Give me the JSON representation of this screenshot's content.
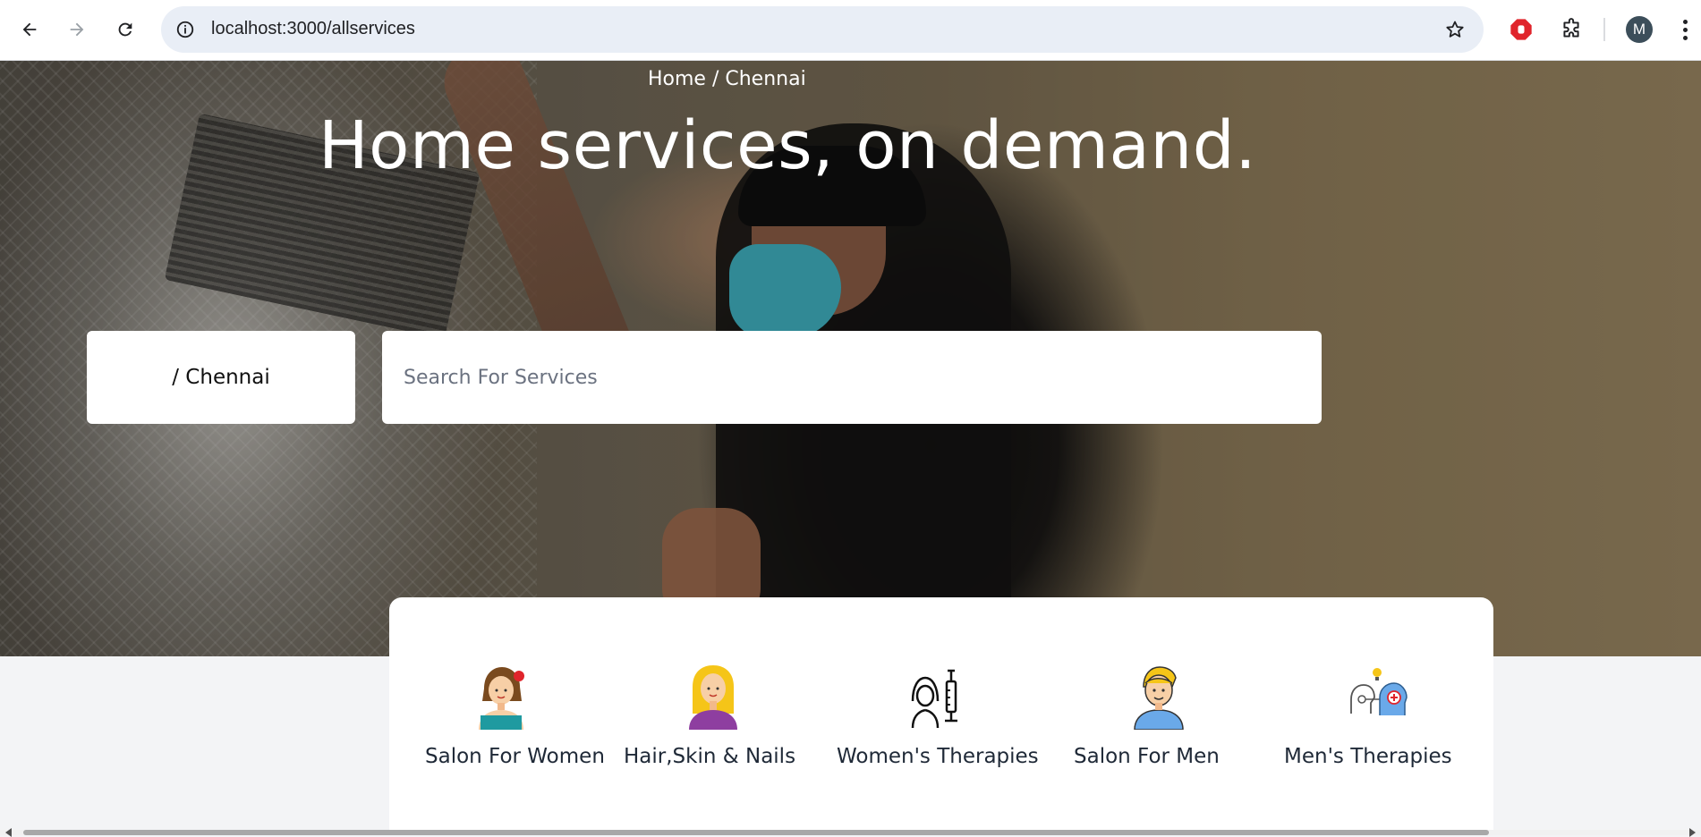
{
  "browser": {
    "url": "localhost:3000/allservices",
    "profile_initial": "M",
    "icons": {
      "back": "arrow-left-icon",
      "forward": "arrow-right-icon",
      "reload": "reload-icon",
      "site_info": "info-icon",
      "bookmark": "star-icon",
      "adblock": "stop-hand-icon",
      "extensions": "puzzle-icon",
      "menu": "kebab-menu-icon"
    }
  },
  "hero": {
    "breadcrumb": "Home / Chennai",
    "title": "Home services, on demand.",
    "city_selector": "/ Chennai",
    "search_placeholder": "Search For Services"
  },
  "categories": [
    {
      "label": "Salon For Women",
      "icon": "woman-salon-icon"
    },
    {
      "label": "Hair,Skin & Nails",
      "icon": "woman-hair-icon"
    },
    {
      "label": "Women's Therapies",
      "icon": "woman-syringe-icon"
    },
    {
      "label": "Salon For Men",
      "icon": "man-salon-icon"
    },
    {
      "label": "Men's Therapies",
      "icon": "head-therapy-icon"
    }
  ],
  "colors": {
    "accent_red": "#e0242b",
    "page_bg": "#f3f4f6",
    "omnibox_bg": "#e9eef6"
  }
}
